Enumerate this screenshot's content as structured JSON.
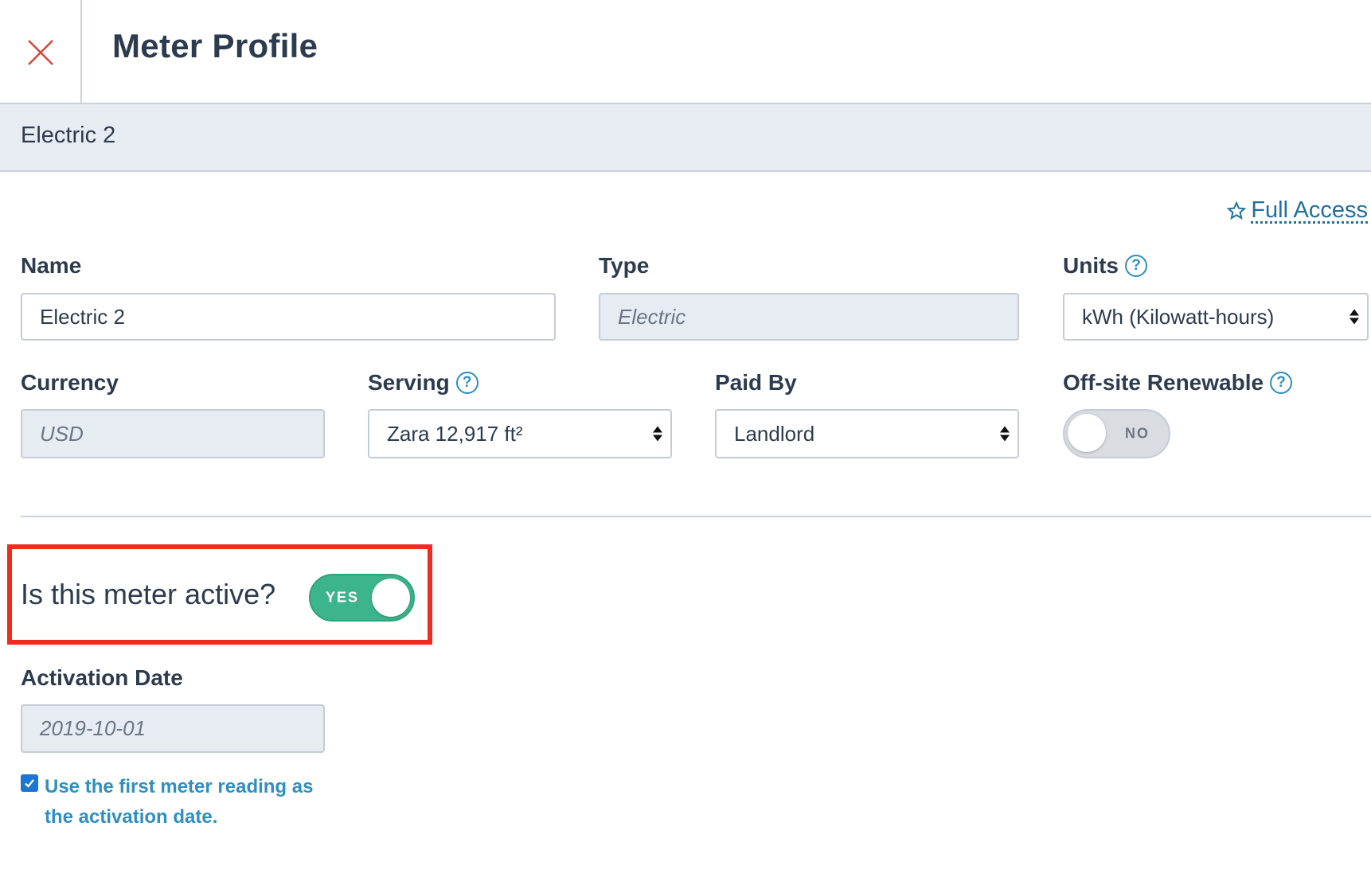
{
  "header": {
    "title": "Meter Profile",
    "close_icon": "close-icon"
  },
  "subheader": {
    "meter_name": "Electric 2"
  },
  "access": {
    "icon": "star-outline-icon",
    "label": "Full Access"
  },
  "fields": {
    "name": {
      "label": "Name",
      "value": "Electric 2"
    },
    "type": {
      "label": "Type",
      "value": "Electric"
    },
    "units": {
      "label": "Units",
      "value": "kWh (Kilowatt-hours)"
    },
    "currency": {
      "label": "Currency",
      "value": "USD"
    },
    "serving": {
      "label": "Serving",
      "value": "Zara 12,917 ft²"
    },
    "paid_by": {
      "label": "Paid By",
      "value": "Landlord"
    },
    "offsite_renewable": {
      "label": "Off-site Renewable",
      "state": "NO"
    }
  },
  "active": {
    "question": "Is this meter active?",
    "state": "YES"
  },
  "activation": {
    "label": "Activation Date",
    "value": "2019-10-01",
    "checkbox_checked": true,
    "checkbox_label": "Use the first meter reading as the activation date."
  },
  "colors": {
    "accent_link": "#1f6fa0",
    "toggle_on": "#3cb58c",
    "highlight": "#ef2b20",
    "close_icon": "#d9453a"
  }
}
